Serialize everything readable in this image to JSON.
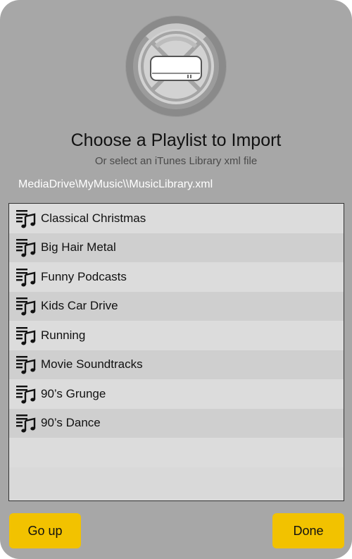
{
  "dialog": {
    "logo_icon": "wireless-drive-icon",
    "title": "Choose a Playlist to Import",
    "subtitle": "Or select an iTunes Library xml file",
    "path": "MediaDrive\\MyMusic\\\\MusicLibrary.xml"
  },
  "playlists": [
    {
      "label": "Classical Christmas",
      "icon": "playlist-icon"
    },
    {
      "label": "Big Hair Metal",
      "icon": "playlist-icon"
    },
    {
      "label": "Funny Podcasts",
      "icon": "playlist-icon"
    },
    {
      "label": "Kids Car Drive",
      "icon": "playlist-icon"
    },
    {
      "label": "Running",
      "icon": "playlist-icon"
    },
    {
      "label": "Movie Soundtracks",
      "icon": "playlist-icon"
    },
    {
      "label": "90’s Grunge",
      "icon": "playlist-icon"
    },
    {
      "label": "90’s Dance",
      "icon": "playlist-icon"
    }
  ],
  "buttons": {
    "go_up": "Go up",
    "done": "Done"
  },
  "colors": {
    "panel": "#a7a7a7",
    "button": "#f2c200",
    "list_bg": "#d9d9d9"
  }
}
